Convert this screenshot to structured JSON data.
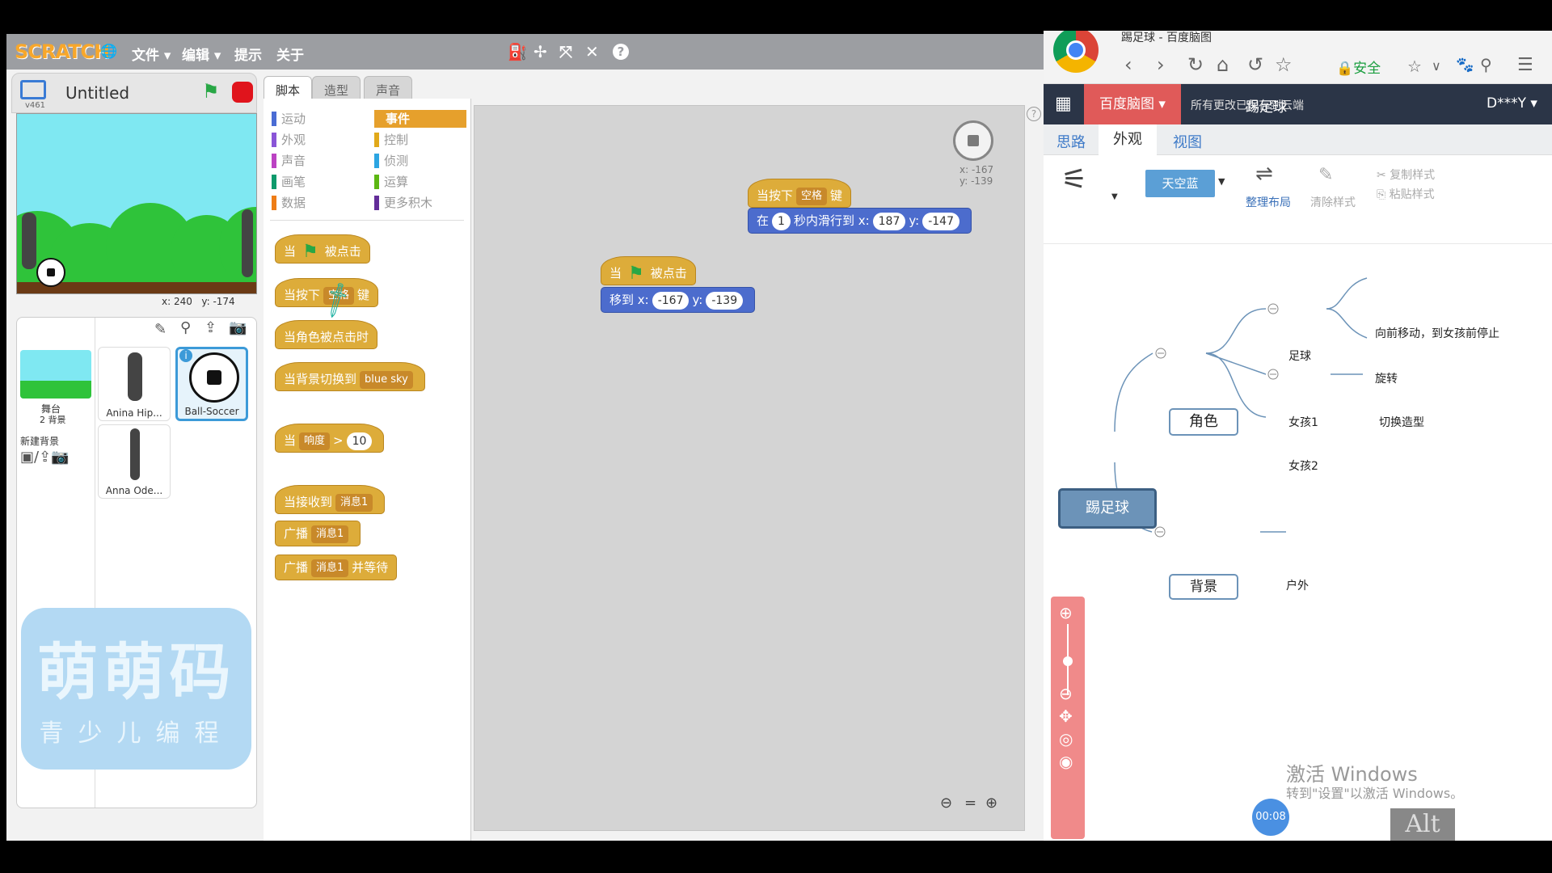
{
  "scratch": {
    "logo": "SCRATCH",
    "menu": [
      "文件 ▾",
      "编辑 ▾",
      "提示",
      "关于"
    ],
    "project_title": "Untitled",
    "version": "v461",
    "stage_coords": {
      "x_label": "x:",
      "x": "240",
      "y_label": "y:",
      "y": "-174"
    },
    "tabs": [
      "脚本",
      "造型",
      "声音"
    ],
    "categories_left": [
      "运动",
      "外观",
      "声音",
      "画笔",
      "数据"
    ],
    "categories_right": [
      "事件",
      "控制",
      "侦测",
      "运算",
      "更多积木"
    ],
    "category_colors_left": [
      "#4a6cd4",
      "#8a55d7",
      "#bb42c3",
      "#0e9a6c",
      "#ee7d16"
    ],
    "category_colors_right": [
      "#c88330",
      "#e1a91a",
      "#2ca5e2",
      "#5cb712",
      "#632d99"
    ],
    "palette_blocks": {
      "when_flag": [
        "当",
        "被点击"
      ],
      "when_key": [
        "当按下",
        "空格",
        "键"
      ],
      "when_sprite_clicked": "当角色被点击时",
      "when_backdrop": [
        "当背景切换到",
        "blue sky"
      ],
      "when_loudness": [
        "当",
        "响度",
        ">",
        "10"
      ],
      "when_receive": [
        "当接收到",
        "消息1"
      ],
      "broadcast": [
        "广播",
        "消息1"
      ],
      "broadcast_wait": [
        "广播",
        "消息1",
        "并等待"
      ]
    },
    "script_blocks": {
      "script1_hat": [
        "当按下",
        "空格",
        "键"
      ],
      "script1_glide": [
        "在",
        "1",
        "秒内滑行到 x:",
        "187",
        "y:",
        "-147"
      ],
      "script2_hat": [
        "当",
        "被点击"
      ],
      "script2_goto": [
        "移到 x:",
        "-167",
        "y:",
        "-139"
      ]
    },
    "sprite_xy": {
      "x": "x: -167",
      "y": "y: -139"
    },
    "stage_thumb": {
      "label": "舞台",
      "sub": "2 背景"
    },
    "new_backdrop": "新建背景",
    "sprites": [
      "Anina Hip...",
      "Ball-Soccer",
      "Anna Ode..."
    ],
    "watermark": {
      "line1": "萌萌码",
      "line2": "青少儿编程"
    }
  },
  "browser": {
    "tab_title": "踢足球 - 百度脑图",
    "secure": "安全",
    "brand": "百度脑图 ▾",
    "save_status": "所有更改已保存到云端",
    "doc_title": "踢足球",
    "user": "D***Y ▾",
    "ribbon_tabs": [
      "思路",
      "外观",
      "视图"
    ],
    "theme_button": "天空蓝",
    "tools": {
      "arrange": "整理布局",
      "clear_style": "清除样式",
      "copy_style": "复制样式",
      "paste_style": "粘贴样式"
    }
  },
  "mindmap": {
    "root": "踢足球",
    "role": "角色",
    "background": "背景",
    "football": "足球",
    "girl1": "女孩1",
    "girl2": "女孩2",
    "outdoor": "户外",
    "move": "向前移动，到女孩前停止",
    "spin": "旋转",
    "switch_costume": "切换造型"
  },
  "overlay": {
    "activate_title": "激活 Windows",
    "activate_sub": "转到\"设置\"以激活 Windows。",
    "timer": "00:08",
    "alt_key": "Alt"
  }
}
